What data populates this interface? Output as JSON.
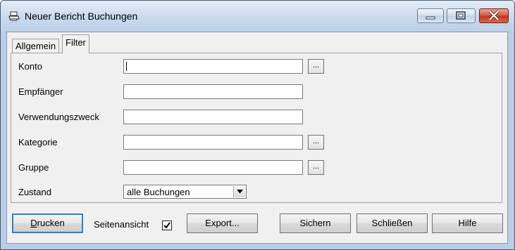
{
  "window": {
    "title": "Neuer Bericht Buchungen",
    "icon": "printer-icon",
    "controls": [
      "minimize-icon",
      "maximize-icon",
      "close-icon"
    ]
  },
  "tabs": [
    {
      "label": "Allgemein",
      "active": false
    },
    {
      "label": "Filter",
      "active": true
    }
  ],
  "filter": {
    "konto": {
      "label": "Konto",
      "value": "",
      "browse_label": "..."
    },
    "empfaenger": {
      "label": "Empfänger",
      "value": ""
    },
    "verwendungszweck": {
      "label": "Verwendungszweck",
      "value": ""
    },
    "kategorie": {
      "label": "Kategorie",
      "value": "",
      "browse_label": "..."
    },
    "gruppe": {
      "label": "Gruppe",
      "value": "",
      "browse_label": "..."
    },
    "zustand": {
      "label": "Zustand",
      "selected": "alle Buchungen"
    }
  },
  "bottom": {
    "drucken_first": "D",
    "drucken_rest": "rucken",
    "seitenansicht_label": "Seitenansicht",
    "seitenansicht_checked": true,
    "export_label": "Export...",
    "sichern_label": "Sichern",
    "schliessen_label": "Schließen",
    "hilfe_label": "Hilfe"
  },
  "colors": {
    "titlebar": "#c9d9ed",
    "close_button": "#c2341b",
    "default_button_border": "#3c7fb1",
    "dialog_face": "#f0f0f0"
  }
}
